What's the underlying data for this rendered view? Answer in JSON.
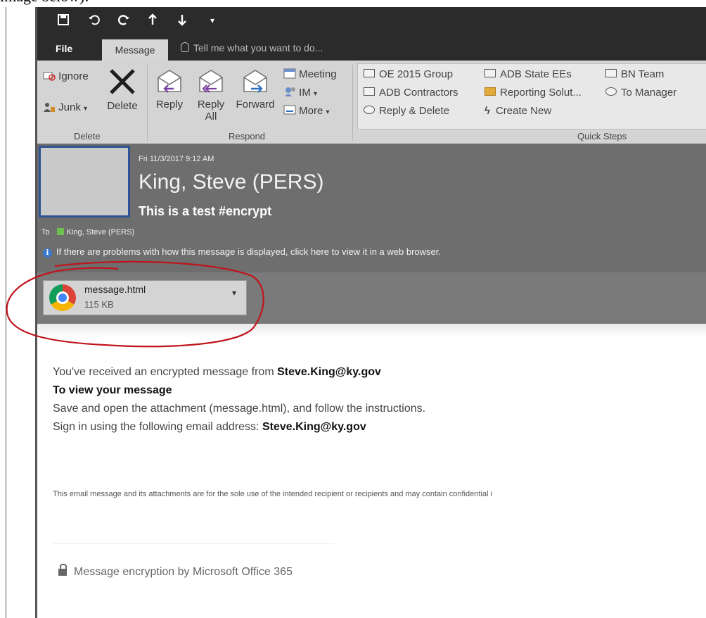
{
  "caption": "image below):",
  "qat": {
    "save_icon": "save-icon",
    "undo_icon": "undo-icon",
    "redo_icon": "redo-icon",
    "up_icon": "up-arrow-icon",
    "down_icon": "down-arrow-icon",
    "more": "▾"
  },
  "tabs": {
    "file": "File",
    "message": "Message",
    "tell_me": "Tell me what you want to do..."
  },
  "ribbon": {
    "delete_group": {
      "ignore": "Ignore",
      "junk": "Junk",
      "delete": "Delete",
      "label": "Delete"
    },
    "respond_group": {
      "reply": "Reply",
      "reply_all_1": "Reply",
      "reply_all_2": "All",
      "forward": "Forward",
      "meeting": "Meeting",
      "im": "IM",
      "more": "More",
      "label": "Respond"
    },
    "quick_steps": {
      "label": "Quick Steps",
      "items": [
        "OE 2015 Group",
        "ADB State EEs",
        "BN Team",
        "ADB Contractors",
        "Reporting Solut...",
        "To Manager",
        "Reply & Delete",
        "Create New"
      ]
    }
  },
  "header": {
    "date": "Fri 11/3/2017 9:12 AM",
    "sender": "King, Steve (PERS)",
    "subject": "This is a test #encrypt",
    "to_label": "To",
    "to_value": "King, Steve (PERS)",
    "info": "If there are problems with how this message is displayed, click here to view it in a web browser."
  },
  "attachment": {
    "name": "message.html",
    "size": "115 KB"
  },
  "body": {
    "line1_prefix": "You've received an encrypted message from ",
    "line1_email": "Steve.King@ky.gov",
    "heading": "To view your message",
    "line3": "Save and open the attachment (message.html), and follow the instructions.",
    "line4_prefix": "Sign in using the following email address: ",
    "line4_email": "Steve.King@ky.gov",
    "disclaimer": "This email message and its attachments are for the sole use of the intended recipient or recipients and may contain confidential i",
    "footer": "Message encryption by Microsoft Office 365"
  },
  "colors": {
    "annotation": "#c0141c",
    "avatar_border": "#2f5496",
    "ribbon": "#d4d4d4",
    "header_bg": "#6e6e6e"
  }
}
